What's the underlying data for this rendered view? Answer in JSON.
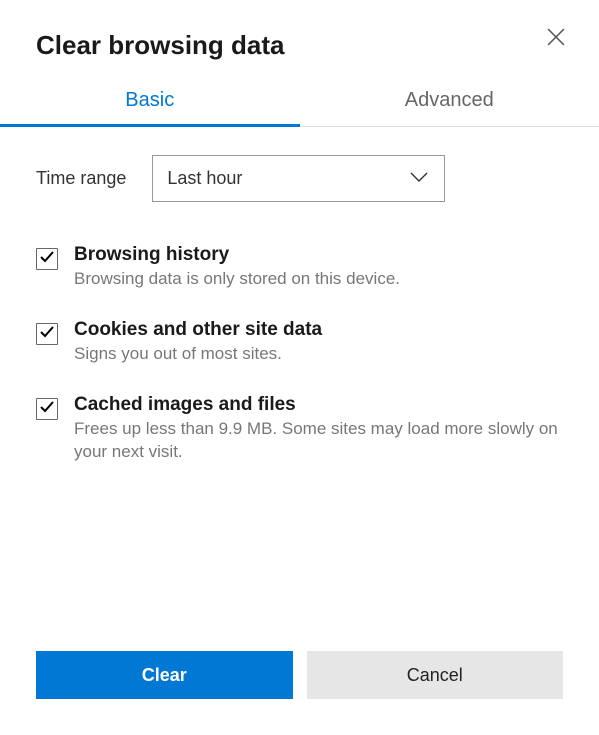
{
  "title": "Clear browsing data",
  "tabs": {
    "basic": "Basic",
    "advanced": "Advanced"
  },
  "timeRange": {
    "label": "Time range",
    "value": "Last hour"
  },
  "options": [
    {
      "title": "Browsing history",
      "desc": "Browsing data is only stored on this device."
    },
    {
      "title": "Cookies and other site data",
      "desc": "Signs you out of most sites."
    },
    {
      "title": "Cached images and files",
      "desc": "Frees up less than 9.9 MB. Some sites may load more slowly on your next visit."
    }
  ],
  "buttons": {
    "clear": "Clear",
    "cancel": "Cancel"
  }
}
